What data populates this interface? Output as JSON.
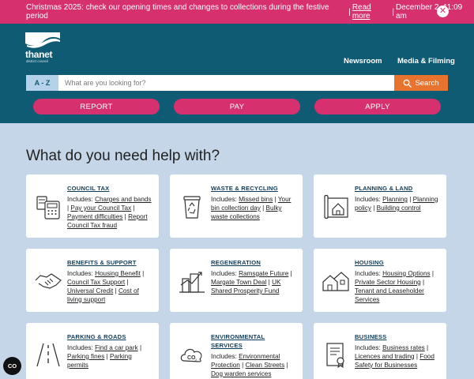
{
  "banner": {
    "message": "Christmas 2025: check our opening times and changes to collections during the festive period",
    "link": "Read more",
    "datetime": "December 2, 11:09 am",
    "close_icon": "close-icon"
  },
  "header": {
    "logo_text": "thanet",
    "logo_sub": "district council",
    "nav": [
      "Newsroom",
      "Media & Filming"
    ]
  },
  "search": {
    "az_label": "A - Z",
    "placeholder": "What are you looking for?",
    "button_label": "Search"
  },
  "actions": [
    "REPORT",
    "PAY",
    "APPLY"
  ],
  "main": {
    "heading": "What do you need help with?"
  },
  "cards": [
    {
      "title": "COUNCIL TAX",
      "icon": "calculator-icon",
      "links": [
        "Charges and bands",
        "Pay your Council Tax",
        "Payment difficulties",
        "Report Council Tax fraud"
      ]
    },
    {
      "title": "WASTE & RECYCLING",
      "icon": "recycling-bin-icon",
      "links": [
        "Missed bins",
        "Your bin collection day",
        "Bulky waste collections"
      ]
    },
    {
      "title": "PLANNING & LAND",
      "icon": "house-plan-icon",
      "links": [
        "Planning",
        "Planning policy",
        "Building control"
      ]
    },
    {
      "title": "BENEFITS & SUPPORT",
      "icon": "handshake-icon",
      "links": [
        "Housing Benefit",
        "Council Tax Support",
        "Universal Credit",
        "Cost of living support"
      ]
    },
    {
      "title": "REGENERATION",
      "icon": "building-growth-icon",
      "links": [
        "Ramsgate Future",
        "Margate Town Deal",
        "UK Shared Prosperity Fund"
      ]
    },
    {
      "title": "HOUSING",
      "icon": "houses-icon",
      "links": [
        "Housing Options",
        "Private Sector Housing",
        "Tenant and Leaseholder Services"
      ]
    },
    {
      "title": "PARKING & ROADS",
      "icon": "road-icon",
      "links": [
        "Find a car park",
        "Parking fines",
        "Parking permits"
      ]
    },
    {
      "title": "ENVIRONMENTAL SERVICES",
      "icon": "co2-cloud-icon",
      "links": [
        "Environmental Protection",
        "Clean Streets",
        "Dog warden services"
      ]
    },
    {
      "title": "BUSINESS",
      "icon": "certificate-icon",
      "links": [
        "Business rates",
        "Licences and trading",
        "Food Safety for Businesses"
      ]
    }
  ],
  "includes_label": "Includes:",
  "cookie_label": "CO",
  "colors": {
    "brand_teal": "#0f5b73",
    "accent_pink": "#d6306e",
    "search_orange": "#e8732f",
    "page_bg": "#c5d6e8"
  }
}
